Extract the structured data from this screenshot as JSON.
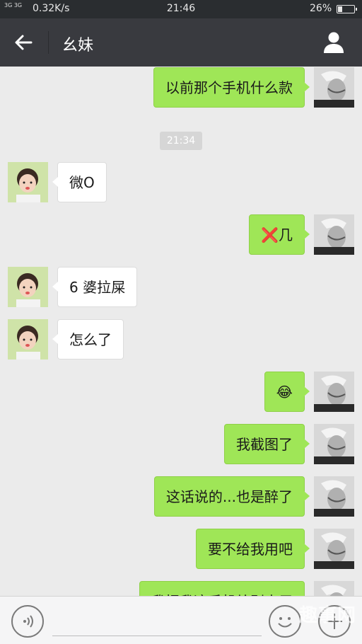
{
  "status_bar": {
    "network": "3G 3G",
    "speed": "0.32K/s",
    "time": "21:46",
    "battery_text": "26%",
    "battery_level": 0.26
  },
  "header": {
    "title": "幺妹"
  },
  "chat": {
    "timestamp": "21:34",
    "messages": [
      {
        "side": "right",
        "text": "以前那个手机什么款"
      },
      {
        "side": "left",
        "text": "微O"
      },
      {
        "side": "right",
        "mark": "❌",
        "text": "几"
      },
      {
        "side": "left",
        "text": "6 婆拉屎"
      },
      {
        "side": "left",
        "text": "怎么了"
      },
      {
        "side": "right",
        "text": "😂"
      },
      {
        "side": "right",
        "text": "我截图了"
      },
      {
        "side": "right",
        "text": "这话说的...也是醉了"
      },
      {
        "side": "right",
        "text": "要不给我用吧"
      },
      {
        "side": "right",
        "text": "我把我这手机给别人用"
      }
    ]
  },
  "input_bar": {
    "watermark": "趣事网"
  },
  "colors": {
    "header_bg": "#393a3f",
    "status_bg": "#2a2d30",
    "chat_bg": "#ebebeb",
    "sent_bubble": "#9fe657",
    "received_bubble": "#ffffff"
  }
}
